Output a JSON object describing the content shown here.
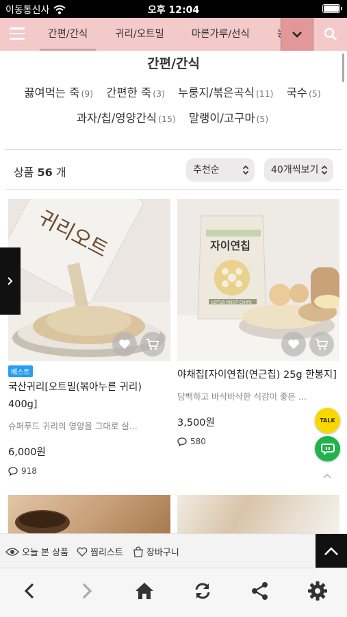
{
  "status_bar": {
    "carrier": "이동통신사",
    "time": "오후 12:04"
  },
  "category_nav": {
    "tabs": [
      {
        "label": "간편/간식",
        "active": true
      },
      {
        "label": "귀리/오트밀",
        "active": false
      },
      {
        "label": "마른가루/선식",
        "active": false
      },
      {
        "label": "농",
        "active": false
      }
    ]
  },
  "subcategory": {
    "title": "간편/간식",
    "items": [
      {
        "label": "끓여먹는 죽",
        "count": "(9)"
      },
      {
        "label": "간편한 죽",
        "count": "(3)"
      },
      {
        "label": "누룽지/볶은곡식",
        "count": "(11)"
      },
      {
        "label": "국수",
        "count": "(5)"
      },
      {
        "label": "과자/칩/영양간식",
        "count": "(15)"
      },
      {
        "label": "말랭이/고구마",
        "count": "(5)"
      }
    ]
  },
  "list_toolbar": {
    "count_prefix": "상품 ",
    "count": "56",
    "count_suffix": " 개",
    "sort_value": "추천순",
    "per_page_value": "40개씩보기"
  },
  "products": [
    {
      "badge": "베스트",
      "name": "국산귀리[오트밀(볶아누른 귀리) 400g]",
      "description": "슈퍼푸드 귀리의 영양을 그대로 살...",
      "price": "6,000원",
      "reviews": "918",
      "package_text": "귀리오트"
    },
    {
      "badge": "",
      "name": "야채칩[자이연칩(연근칩) 25g 한봉지]",
      "description": "담백하고 바삭바삭한 식감이 좋은 ...",
      "price": "3,500원",
      "reviews": "580",
      "package_text": "자이연칩",
      "package_subtext": "LOTUS ROOT CHIPS"
    }
  ],
  "floating": {
    "talk_label": "TALK"
  },
  "recent_bar": {
    "today_viewed": "오늘 본 상품",
    "wishlist": "찜리스트",
    "cart": "장바구니"
  },
  "icons": {
    "wifi": "wifi-icon",
    "battery": "battery-icon",
    "menu": "hamburger-icon",
    "dropdown": "chevron-down-icon",
    "search": "search-icon",
    "heart": "heart-icon",
    "cart": "cart-icon",
    "comment": "comment-icon",
    "eye": "eye-icon",
    "bag": "bag-icon",
    "back": "back-icon",
    "forward": "forward-icon",
    "home": "home-icon",
    "refresh": "refresh-icon",
    "share": "share-icon",
    "settings": "gear-icon"
  },
  "colors": {
    "nav_bg": "#f3c9c9",
    "nav_active_btn": "#e29898",
    "badge": "#2a9df4",
    "talk": "#f7d900",
    "chat": "#21b24d"
  }
}
